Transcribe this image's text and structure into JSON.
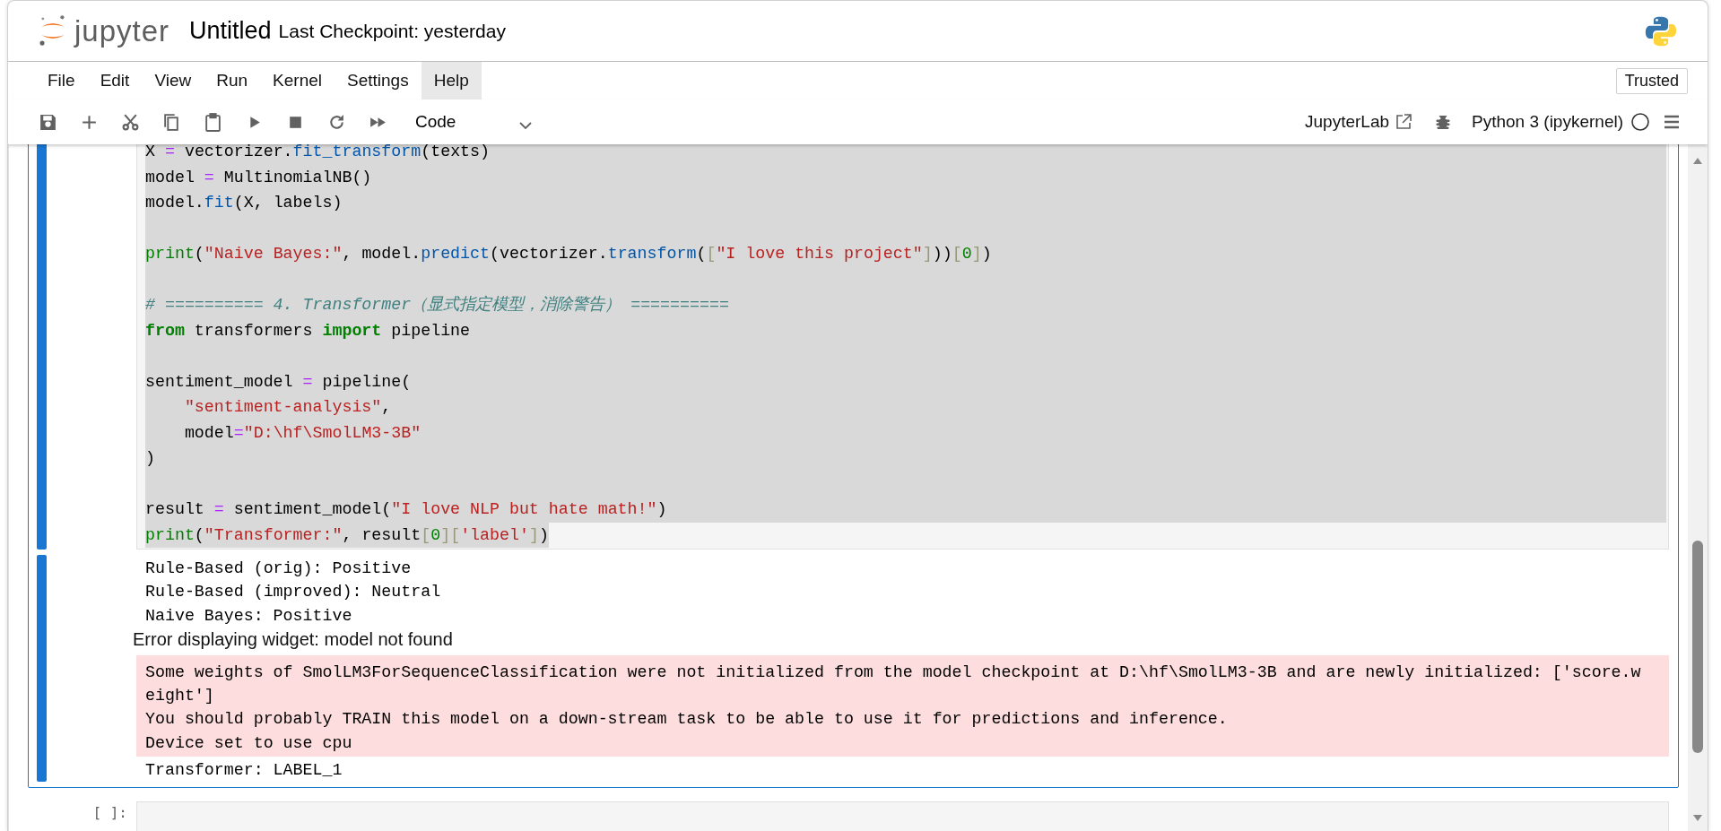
{
  "header": {
    "logo_text": "jupyter",
    "title": "Untitled",
    "checkpoint": "Last Checkpoint: yesterday"
  },
  "menu": [
    {
      "label": "File",
      "selected": false
    },
    {
      "label": "Edit",
      "selected": false
    },
    {
      "label": "View",
      "selected": false
    },
    {
      "label": "Run",
      "selected": false
    },
    {
      "label": "Kernel",
      "selected": false
    },
    {
      "label": "Settings",
      "selected": false
    },
    {
      "label": "Help",
      "selected": true
    }
  ],
  "trusted_button": "Trusted",
  "toolbar": {
    "cell_type": "Code",
    "open_in": "JupyterLab",
    "kernel": "Python 3 (ipykernel)",
    "kernel_busy": false
  },
  "cells": [
    {
      "active": true,
      "code_lines": [
        {
          "selected": true,
          "tokens": [
            {
              "kind": "name",
              "text": "X "
            },
            {
              "kind": "op",
              "text": "="
            },
            {
              "kind": "name",
              "text": " vectorizer."
            },
            {
              "kind": "fn",
              "text": "fit_transform"
            },
            {
              "kind": "name",
              "text": "(texts)"
            }
          ]
        },
        {
          "selected": true,
          "tokens": [
            {
              "kind": "name",
              "text": "model "
            },
            {
              "kind": "op",
              "text": "="
            },
            {
              "kind": "name",
              "text": " MultinomialNB()"
            }
          ]
        },
        {
          "selected": true,
          "tokens": [
            {
              "kind": "name",
              "text": "model."
            },
            {
              "kind": "fn",
              "text": "fit"
            },
            {
              "kind": "name",
              "text": "(X, labels)"
            }
          ]
        },
        {
          "selected": true
        },
        {
          "selected": true,
          "tokens": [
            {
              "kind": "builtin",
              "text": "print"
            },
            {
              "kind": "name",
              "text": "("
            },
            {
              "kind": "str",
              "text": "\"Naive Bayes:\""
            },
            {
              "kind": "name",
              "text": ", model."
            },
            {
              "kind": "fn",
              "text": "predict"
            },
            {
              "kind": "name",
              "text": "(vectorizer."
            },
            {
              "kind": "fn",
              "text": "transform"
            },
            {
              "kind": "name",
              "text": "("
            },
            {
              "kind": "bracket",
              "text": "["
            },
            {
              "kind": "str",
              "text": "\"I love this project\""
            },
            {
              "kind": "bracket",
              "text": "]"
            },
            {
              "kind": "name",
              "text": "))"
            },
            {
              "kind": "bracket",
              "text": "["
            },
            {
              "kind": "num",
              "text": "0"
            },
            {
              "kind": "bracket",
              "text": "]"
            },
            {
              "kind": "name",
              "text": ")"
            }
          ]
        },
        {
          "selected": true
        },
        {
          "selected": true,
          "tokens": [
            {
              "kind": "comment",
              "text": "# ========== 4. Transformer（显式指定模型，消除警告） =========="
            }
          ]
        },
        {
          "selected": true,
          "tokens": [
            {
              "kind": "keyword",
              "text": "from"
            },
            {
              "kind": "name",
              "text": " transformers "
            },
            {
              "kind": "keyword",
              "text": "import"
            },
            {
              "kind": "name",
              "text": " pipeline"
            }
          ]
        },
        {
          "selected": true
        },
        {
          "selected": true,
          "tokens": [
            {
              "kind": "name",
              "text": "sentiment_model "
            },
            {
              "kind": "op",
              "text": "="
            },
            {
              "kind": "name",
              "text": " pipeline("
            }
          ]
        },
        {
          "selected": true,
          "tokens": [
            {
              "kind": "str",
              "text": "    \"sentiment-analysis\""
            },
            {
              "kind": "name",
              "text": ","
            }
          ]
        },
        {
          "selected": true,
          "tokens": [
            {
              "kind": "name",
              "text": "    model"
            },
            {
              "kind": "op",
              "text": "="
            },
            {
              "kind": "str",
              "text": "\"D:\\hf\\SmolLM3-3B\""
            }
          ]
        },
        {
          "selected": true,
          "tokens": [
            {
              "kind": "name",
              "text": ")"
            }
          ]
        },
        {
          "selected": true
        },
        {
          "selected": true,
          "tokens": [
            {
              "kind": "name",
              "text": "result "
            },
            {
              "kind": "op",
              "text": "="
            },
            {
              "kind": "name",
              "text": " sentiment_model("
            },
            {
              "kind": "str",
              "text": "\"I love NLP but hate math!\""
            },
            {
              "kind": "name",
              "text": ")"
            }
          ]
        },
        {
          "selected": true,
          "tokens": [
            {
              "kind": "builtin",
              "text": "print"
            },
            {
              "kind": "name",
              "text": "("
            },
            {
              "kind": "str",
              "text": "\"Transformer:\""
            },
            {
              "kind": "name",
              "text": ", result"
            },
            {
              "kind": "bracket",
              "text": "["
            },
            {
              "kind": "num",
              "text": "0"
            },
            {
              "kind": "bracket",
              "text": "]["
            },
            {
              "kind": "str",
              "text": "'label'"
            },
            {
              "kind": "bracket",
              "text": "]"
            },
            {
              "kind": "name",
              "text": ")"
            }
          ]
        }
      ],
      "outputs": [
        {
          "kind": "stdout",
          "lines": [
            "Rule-Based (orig): Positive",
            "Rule-Based (improved): Neutral",
            "Naive Bayes: Positive"
          ]
        },
        {
          "kind": "widget_error",
          "text": "Error displaying widget: model not found"
        },
        {
          "kind": "stderr",
          "lines": [
            "Some weights of SmolLM3ForSequenceClassification were not initialized from the model checkpoint at D:\\hf\\SmolLM3-3B and are newly initialized: ['score.w",
            "eight']",
            "You should probably TRAIN this model on a down-stream task to be able to use it for predictions and inference.",
            "Device set to use cpu"
          ]
        },
        {
          "kind": "stdout",
          "lines": [
            "Transformer: LABEL_1"
          ]
        }
      ]
    },
    {
      "active": false,
      "prompt": "[ ]:"
    }
  ]
}
